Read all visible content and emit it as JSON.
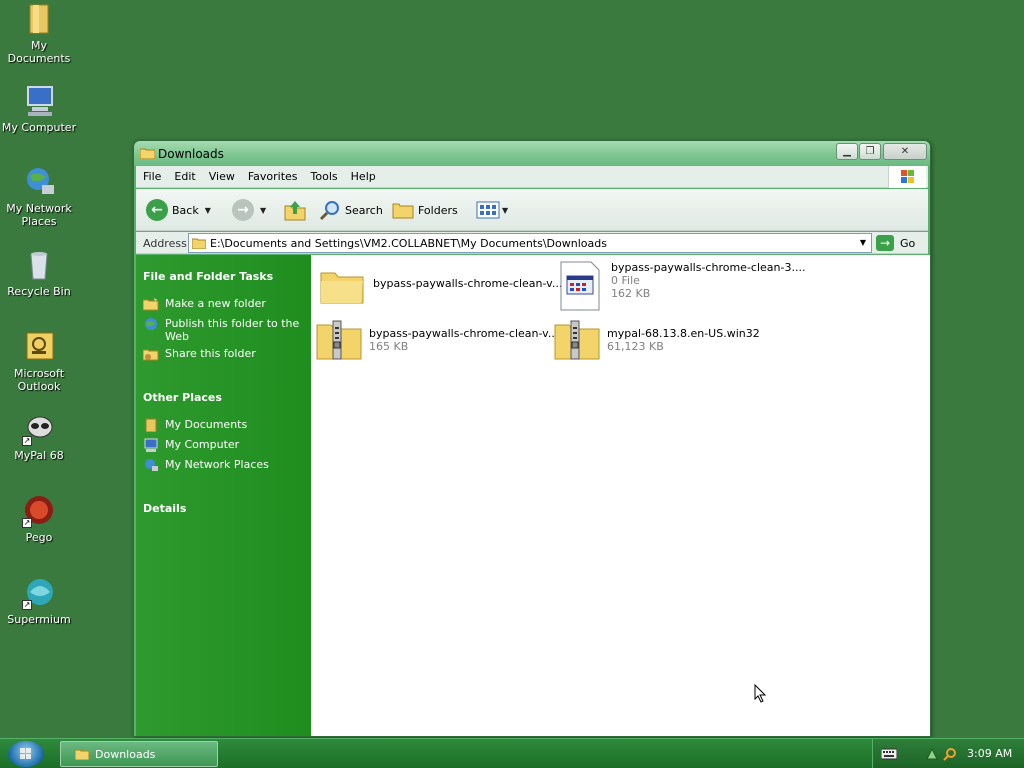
{
  "desktop": {
    "icons": [
      {
        "label": "My\nDocuments",
        "icon": "my-documents-icon"
      },
      {
        "label": "My Computer",
        "icon": "my-computer-icon"
      },
      {
        "label": "My Network\nPlaces",
        "icon": "network-places-icon"
      },
      {
        "label": "Recycle Bin",
        "icon": "recycle-bin-icon"
      },
      {
        "label": "Microsoft\nOutlook",
        "icon": "outlook-icon"
      },
      {
        "label": "MyPal 68",
        "icon": "mypal-icon"
      },
      {
        "label": "Pego",
        "icon": "pego-icon"
      },
      {
        "label": "Supermium",
        "icon": "supermium-icon"
      }
    ]
  },
  "window": {
    "title": "Downloads",
    "menu": [
      "File",
      "Edit",
      "View",
      "Favorites",
      "Tools",
      "Help"
    ],
    "toolbar": {
      "back": "Back",
      "search": "Search",
      "folders": "Folders"
    },
    "address": {
      "label": "Address",
      "value": "E:\\Documents and Settings\\VM2.COLLABNET\\My Documents\\Downloads",
      "go": "Go"
    },
    "sidebar": {
      "tasks_title": "File and Folder Tasks",
      "tasks": [
        "Make a new folder",
        "Publish this folder to the\nWeb",
        "Share this folder"
      ],
      "other_title": "Other Places",
      "other": [
        "My Documents",
        "My Computer",
        "My Network Places"
      ],
      "details_title": "Details"
    },
    "files": [
      {
        "name": "bypass-paywalls-chrome-clean-v...",
        "meta1": "",
        "meta2": "",
        "type": "folder"
      },
      {
        "name": "bypass-paywalls-chrome-clean-3....",
        "meta1": "0 File",
        "meta2": "162 KB",
        "type": "generic-file"
      },
      {
        "name": "bypass-paywalls-chrome-clean-v...",
        "meta1": "165 KB",
        "meta2": "",
        "type": "zip-folder"
      },
      {
        "name": "mypal-68.13.8.en-US.win32",
        "meta1": "61,123 KB",
        "meta2": "",
        "type": "zip-folder"
      }
    ]
  },
  "taskbar": {
    "task": "Downloads",
    "clock": "3:09 AM"
  },
  "colors": {
    "desktop": "#3a7a3e",
    "sidebar": "#2f9a2f",
    "titlebar": "#7cc590"
  }
}
